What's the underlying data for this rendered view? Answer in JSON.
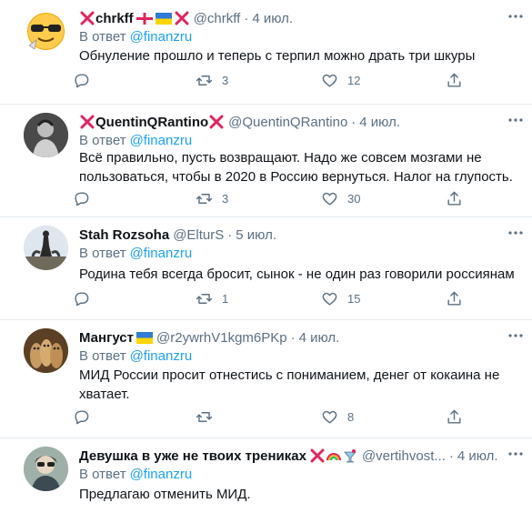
{
  "tweets": [
    {
      "name": "chrkff",
      "handle": "@chrkff",
      "dot": "·",
      "time": "4 июл.",
      "reply_prefix": "В ответ",
      "reply_to": "@finanzru",
      "text": "Обнуление прошло и теперь с терпил можно драть три шкуры",
      "retweets": "3",
      "likes": "12",
      "avatar_icon": "sunglasses-emoji"
    },
    {
      "name": "QuentinQRantino",
      "handle": "@QuentinQRantino",
      "dot": "·",
      "time": "4 июл.",
      "reply_prefix": "В ответ",
      "reply_to": "@finanzru",
      "text": "Всё правильно, пусть возвращают. Надо же совсем мозгами не пользоваться, чтобы в 2020 в Россию вернуться. Налог на глупость.",
      "retweets": "3",
      "likes": "30",
      "avatar_icon": "photo-avatar"
    },
    {
      "name": "Stah Rozsoha",
      "handle": "@ElturS",
      "dot": "·",
      "time": "5 июл.",
      "reply_prefix": "В ответ",
      "reply_to": "@finanzru",
      "text": "Родина тебя всегда бросит, сынок - не один раз говорили россиянам",
      "retweets": "1",
      "likes": "15",
      "avatar_icon": "statue-photo-avatar"
    },
    {
      "name": "Мангуст",
      "handle": "@r2ywrhV1kgm6PKp",
      "dot": "·",
      "time": "4 июл.",
      "reply_prefix": "В ответ",
      "reply_to": "@finanzru",
      "text": "МИД России просит отнестись с пониманием, денег от кокаина не хватает.",
      "retweets": "",
      "likes": "8",
      "avatar_icon": "meerkats-photo-avatar"
    },
    {
      "name": "Девушка в уже не твоих трениках",
      "handle": "@vertihvost...",
      "dot": "·",
      "time": "4 июл.",
      "reply_prefix": "В ответ",
      "reply_to": "@finanzru",
      "text": "Предлагаю отменить МИД.",
      "avatar_icon": "photo-avatar"
    }
  ],
  "colors": {
    "accent": "#1da1f2",
    "muted": "#5b7083",
    "divider": "#e6ecf0",
    "cross_red": "#e0245e"
  }
}
